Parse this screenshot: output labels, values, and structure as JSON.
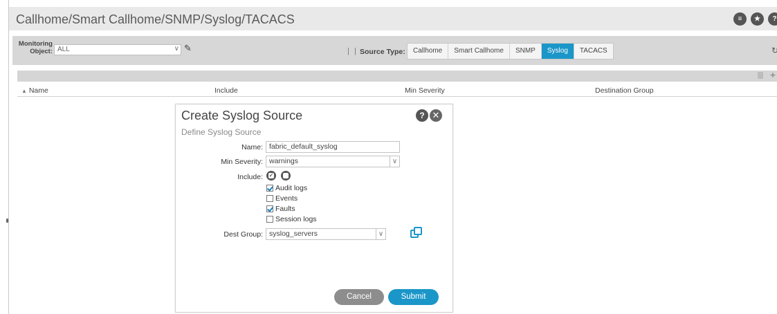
{
  "header": {
    "title": "Callhome/Smart Callhome/SNMP/Syslog/TACACS",
    "icons": [
      "list-icon",
      "star-icon",
      "help-icon"
    ]
  },
  "filter": {
    "monitoring_label": "Monitoring Object:",
    "monitoring_value": "ALL",
    "separator": "|",
    "source_type_label": "Source Type:",
    "source_tabs": [
      "Callhome",
      "Smart Callhome",
      "SNMP",
      "Syslog",
      "TACACS"
    ],
    "active_tab": "Syslog"
  },
  "table": {
    "columns": [
      "Name",
      "Include",
      "Min Severity",
      "Destination Group"
    ]
  },
  "dialog": {
    "title": "Create Syslog Source",
    "subtitle": "Define Syslog Source",
    "name_label": "Name:",
    "name_value": "fabric_default_syslog",
    "severity_label": "Min Severity:",
    "severity_value": "warnings",
    "include_label": "Include:",
    "include_options": [
      {
        "label": "Audit logs",
        "checked": true
      },
      {
        "label": "Events",
        "checked": false
      },
      {
        "label": "Faults",
        "checked": true
      },
      {
        "label": "Session logs",
        "checked": false
      }
    ],
    "dest_label": "Dest Group:",
    "dest_value": "syslog_servers",
    "cancel_label": "Cancel",
    "submit_label": "Submit"
  },
  "colors": {
    "accent": "#1b96c8",
    "cancel": "#8d8d8d"
  }
}
